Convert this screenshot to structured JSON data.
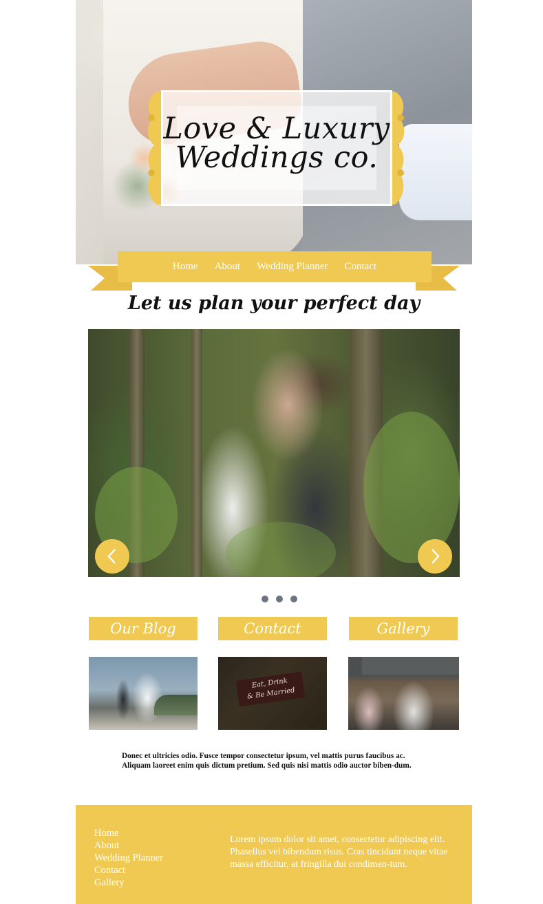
{
  "brand": {
    "logo_line1": "Love & Luxury",
    "logo_line2": "Weddings co."
  },
  "nav": {
    "items": [
      "Home",
      "About",
      "Wedding Planner",
      "Contact"
    ]
  },
  "tagline": "Let us plan your perfect day",
  "slider": {
    "prev_icon": "chevron-left-icon",
    "next_icon": "chevron-right-icon",
    "dots": 3
  },
  "cards": [
    {
      "title": "Our Blog"
    },
    {
      "title": "Contact"
    },
    {
      "title": "Gallery"
    }
  ],
  "contact_image": {
    "sign_line1": "Eat, Drink",
    "sign_line2": "& Be Married"
  },
  "intro_text": "Donec et ultricies odio. Fusce tempor consectetur ipsum, vel mattis purus faucibus ac. Aliquam laoreet enim quis dictum pretium. Sed quis nisi mattis odio auctor biben-dum.",
  "footer": {
    "links": [
      "Home",
      "About",
      "Wedding Planner",
      "Contact",
      "Gallery"
    ],
    "text": "Lorem ipsum dolor sit amet, consectetur adipiscing elit. Phasellus vel bibendum risus. Cras tincidunt neque vitae massa efficitur, at fringilla dui condimen-tum."
  },
  "colors": {
    "accent": "#f0c952",
    "dot": "#6d7580"
  }
}
